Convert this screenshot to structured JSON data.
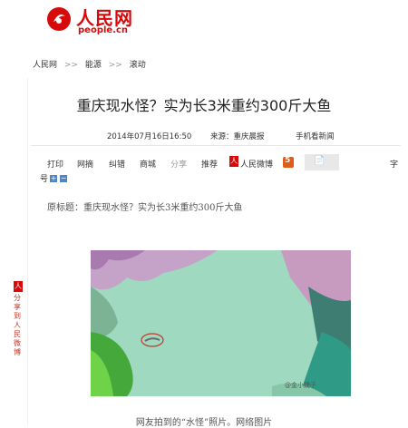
{
  "logo": {
    "name": "人民网",
    "domain": "people.cn"
  },
  "breadcrumb": [
    "人民网",
    "能源",
    "滚动"
  ],
  "breadcrumb_sep": ">>",
  "article": {
    "title": "重庆现水怪？实为长3米重约300斤大鱼",
    "datetime": "2014年07月16日16:50",
    "source": "来源：重庆晨报",
    "mobile": "手机看新闻",
    "origin_title": "原标题：重庆现水怪？实为长3米重约300斤大鱼",
    "caption": "网友拍到的“水怪”照片。网络图片",
    "watermark": "@金小婕子"
  },
  "toolbar": {
    "print": "打印",
    "excerpt": "网摘",
    "correct": "纠错",
    "mall": "商城",
    "share": "分享",
    "recommend": "推荐",
    "weibo": "人民微博",
    "font_zi": "字",
    "font_hao": "号",
    "plus": "+",
    "minus": "−"
  },
  "side_share": {
    "text": "分享到人民微博"
  },
  "colors": {
    "brand_red": "#d60a0a",
    "water": "#8fd8b8",
    "link_blue": "#4e86c9"
  }
}
